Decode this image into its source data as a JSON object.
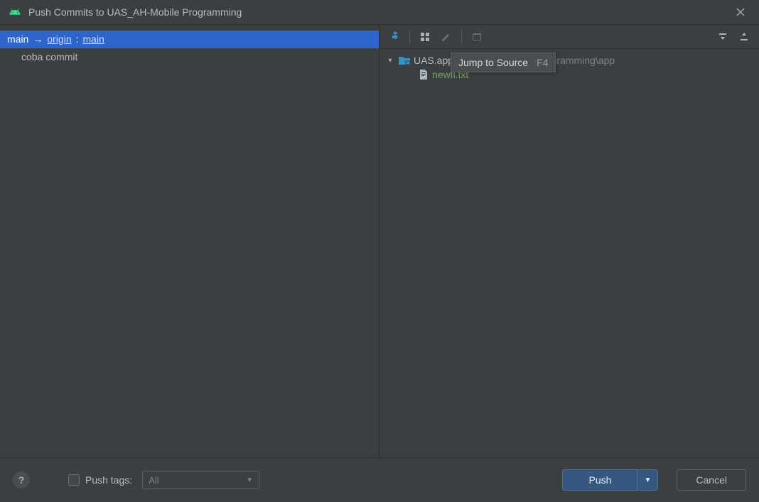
{
  "titlebar": {
    "title": "Push Commits to UAS_AH-Mobile Programming"
  },
  "left": {
    "branch": {
      "local": "main",
      "arrow": "→",
      "remote": "origin",
      "colon": ":",
      "remote_branch": "main"
    },
    "commits": [
      {
        "message": "coba commit"
      }
    ]
  },
  "right": {
    "tooltip": {
      "text": "Jump to Source",
      "shortcut": "F4"
    },
    "tree": {
      "root": {
        "label": "UAS.app",
        "path_tail": "UAS_AH-Mobile Programming\\app"
      },
      "children": [
        {
          "name": "newfl.txt",
          "status_color": "new"
        }
      ]
    }
  },
  "footer": {
    "push_tags_label": "Push tags:",
    "push_tags_select": "All",
    "push_button": "Push",
    "cancel_button": "Cancel"
  }
}
